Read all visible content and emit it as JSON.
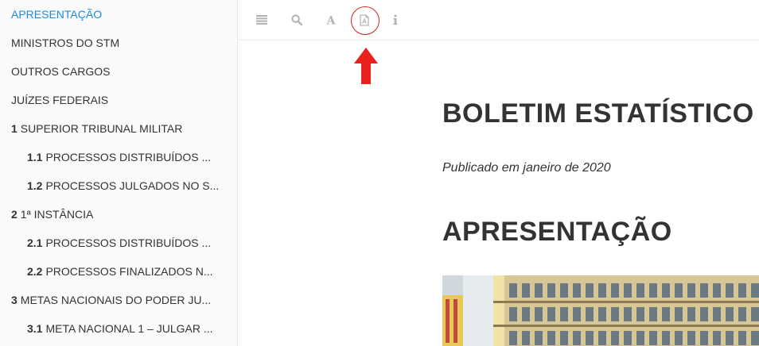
{
  "sidebar": {
    "items": [
      {
        "num": "",
        "label": "APRESENTAÇÃO"
      },
      {
        "num": "",
        "label": "MINISTROS DO STM"
      },
      {
        "num": "",
        "label": "OUTROS CARGOS"
      },
      {
        "num": "",
        "label": "JUÍZES FEDERAIS"
      },
      {
        "num": "1",
        "label": "SUPERIOR TRIBUNAL MILITAR"
      },
      {
        "num": "1.1",
        "label": "PROCESSOS DISTRIBUÍDOS ..."
      },
      {
        "num": "1.2",
        "label": "PROCESSOS JULGADOS NO S..."
      },
      {
        "num": "2",
        "label": "1ª INSTÂNCIA"
      },
      {
        "num": "2.1",
        "label": "PROCESSOS DISTRIBUÍDOS ..."
      },
      {
        "num": "2.2",
        "label": "PROCESSOS FINALIZADOS N..."
      },
      {
        "num": "3",
        "label": "METAS NACIONAIS DO PODER JU..."
      },
      {
        "num": "3.1",
        "label": "META NACIONAL 1 – JULGAR ..."
      }
    ]
  },
  "toolbar": {
    "buttons": [
      "list-icon",
      "search-icon",
      "font-icon",
      "pdf-icon",
      "info-icon"
    ],
    "highlight_color": "#d42323"
  },
  "document": {
    "title": "BOLETIM ESTATÍSTICO",
    "published": "Publicado em janeiro de 2020",
    "section_heading": "APRESENTAÇÃO"
  },
  "colors": {
    "active_link": "#1a8cd8",
    "text": "#333333",
    "sidebar_bg": "#fafafa",
    "annotation_red": "#e8201e"
  }
}
